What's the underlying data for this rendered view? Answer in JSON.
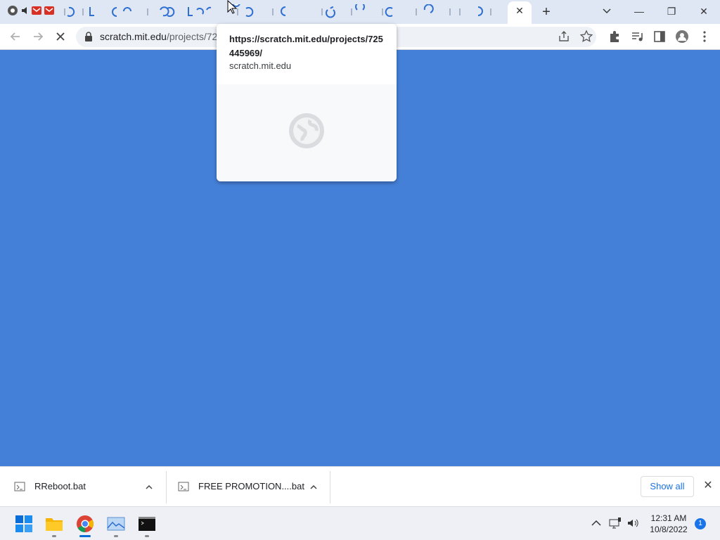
{
  "browser": {
    "tabs_count_label": "",
    "active_tab_close": "✕",
    "new_tab": "+",
    "window": {
      "minimize": "—",
      "restore": "❐",
      "close": "✕"
    },
    "omnibox": {
      "domain": "scratch.mit.edu",
      "path": "/projects/72"
    }
  },
  "hover_card": {
    "title": "https://scratch.mit.edu/projects/725445969/",
    "domain": "scratch.mit.edu"
  },
  "downloads": {
    "items": [
      {
        "name": "RReboot.bat"
      },
      {
        "name": "FREE PROMOTION....bat"
      }
    ],
    "show_all": "Show all",
    "close": "✕"
  },
  "taskbar": {
    "time": "12:31 AM",
    "date": "10/8/2022",
    "notification_count": "1"
  },
  "colors": {
    "page_bg": "#4580d8",
    "accent": "#1a73e8"
  }
}
